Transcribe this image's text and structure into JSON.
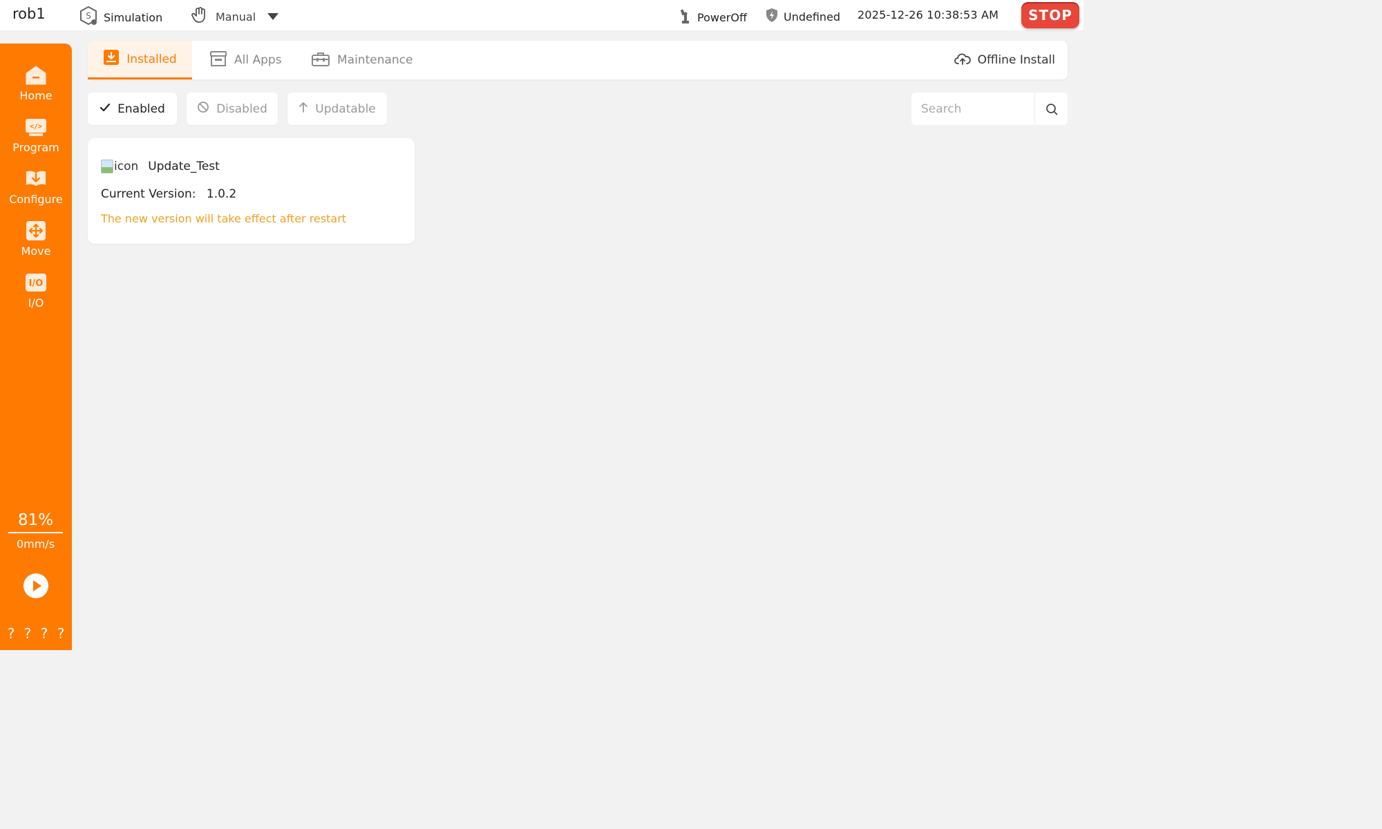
{
  "topbar": {
    "robot_name": "rob1",
    "sim_label": "Simulation",
    "mode_label": "Manual",
    "power_label": "PowerOff",
    "safety_label": "Undefined",
    "datetime": "2025-12-26 10:38:53 AM",
    "stop_label": "STOP"
  },
  "sidebar": {
    "items": [
      {
        "label": "Home",
        "icon": "home-icon"
      },
      {
        "label": "Program",
        "icon": "program-icon"
      },
      {
        "label": "Configure",
        "icon": "configure-icon"
      },
      {
        "label": "Move",
        "icon": "move-icon"
      },
      {
        "label": "I/O",
        "icon": "io-icon"
      }
    ],
    "speed_percent": "81%",
    "speed_value": "0mm/s",
    "bottom_marks": [
      "?",
      "?",
      "?",
      "?"
    ]
  },
  "tabs": {
    "installed": "Installed",
    "all_apps": "All Apps",
    "maintenance": "Maintenance",
    "offline_install": "Offline Install"
  },
  "filters": {
    "enabled": "Enabled",
    "disabled": "Disabled",
    "updatable": "Updatable"
  },
  "search": {
    "placeholder": "Search",
    "value": ""
  },
  "apps": [
    {
      "icon_alt": "icon",
      "name": "Update_Test",
      "version_label": "Current Version:",
      "version": "1.0.2",
      "note": "The new version will take effect after restart"
    }
  ],
  "colors": {
    "accent": "#ff7a00",
    "stop": "#e8463a",
    "note": "#f0a020",
    "background": "#f2f2f2"
  }
}
